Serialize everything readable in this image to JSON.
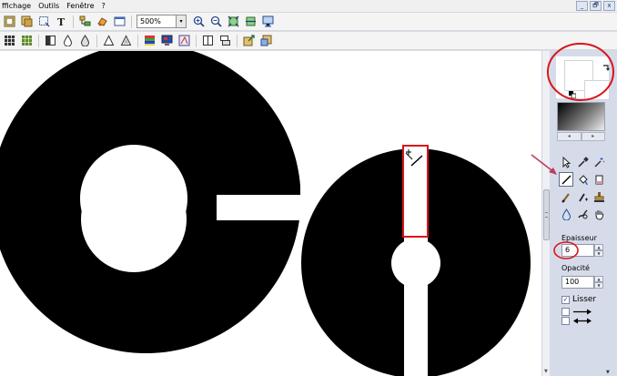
{
  "menu": {
    "items": [
      {
        "label": "ffichage"
      },
      {
        "label": "Outils"
      },
      {
        "label": "Fenêtre"
      },
      {
        "label": "?"
      }
    ]
  },
  "window_controls": {
    "minimize": "_",
    "restore": "🗗",
    "close": "x"
  },
  "toolbar1": {
    "zoom_value": "500%",
    "zoom_dropdown": "▾"
  },
  "panel": {
    "gradient_left": "◂",
    "gradient_right": "▸",
    "thickness_label": "Epaisseur",
    "thickness_value": "6",
    "opacity_label": "Opacité",
    "opacity_value": "100",
    "smooth_label": "Lisser",
    "smooth_check": "✓"
  },
  "colors": {
    "canvas_background": "#ffffff",
    "shape_fill": "#000000",
    "panel_bg": "#d6dbe9",
    "annotation_red": "#d9141b",
    "pointer_arrow": "#c23a5a"
  },
  "icons": {
    "toolbar1": [
      "select-all-icon",
      "copy-image-icon",
      "crop-icon",
      "text-tool-icon",
      "tree-icon",
      "paint-icon",
      "window-icon",
      "zoom-in-icon",
      "zoom-out-icon",
      "fit-window-icon",
      "fit-width-icon",
      "fullscreen-icon"
    ],
    "toolbar2": [
      "grid-icon",
      "grid-color-icon",
      "contrast-icon",
      "drop-icon",
      "drop-outline-icon",
      "triangle-icon",
      "triangle-outline-icon",
      "palette-icon",
      "screen-icon",
      "colorize-icon",
      "split-icon",
      "layers-icon",
      "export-icon",
      "import-icon"
    ],
    "tools": [
      "pointer-tool-icon",
      "eyedropper-tool-icon",
      "magic-wand-tool-icon",
      "line-tool-icon",
      "fill-tool-icon",
      "eraser-tool-icon",
      "brush-tool-icon",
      "airbrush-tool-icon",
      "stamp-tool-icon",
      "drop-tool-icon",
      "smudge-tool-icon",
      "hand-tool-icon"
    ]
  }
}
